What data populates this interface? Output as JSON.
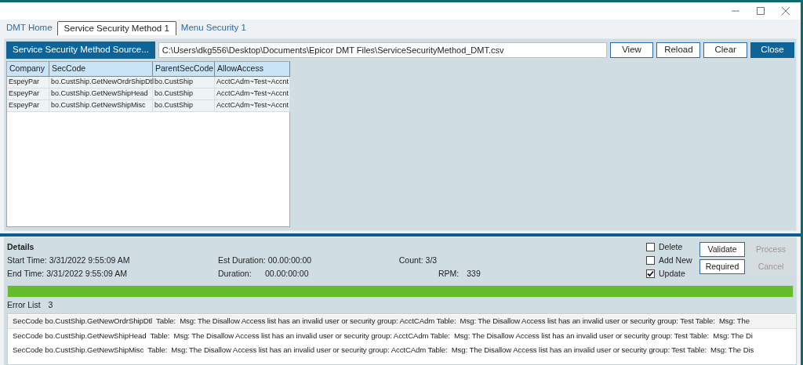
{
  "tabs": [
    {
      "label": "DMT Home",
      "selected": false
    },
    {
      "label": "Service Security Method 1",
      "selected": true
    },
    {
      "label": "Menu Security 1",
      "selected": false
    }
  ],
  "source_button": "Service Security Method Source...",
  "file_path": "C:\\Users\\dkg556\\Desktop\\Documents\\Epicor DMT Files\\ServiceSecurityMethod_DMT.csv",
  "toolbar_buttons": [
    {
      "label": "View",
      "primary": false
    },
    {
      "label": "Reload",
      "primary": false
    },
    {
      "label": "Clear",
      "primary": false
    },
    {
      "label": "Close",
      "primary": true
    }
  ],
  "table": {
    "columns": [
      "Company",
      "SecCode",
      "ParentSecCode",
      "AllowAccess"
    ],
    "rows": [
      [
        "EspeyPar",
        "bo.CustShip.GetNewOrdrShipDtl",
        "bo.CustShip",
        "AcctCAdm~Test~Accnt"
      ],
      [
        "EspeyPar",
        "bo.CustShip.GetNewShipHead",
        "bo.CustShip",
        "AcctCAdm~Test~Accnt"
      ],
      [
        "EspeyPar",
        "bo.CustShip.GetNewShipMisc",
        "bo.CustShip",
        "AcctCAdm~Test~Accnt"
      ]
    ]
  },
  "details": {
    "title": "Details",
    "start_time": "Start Time: 3/31/2022 9:55:09 AM",
    "end_time": "End Time:  3/31/2022 9:55:09 AM",
    "est_duration_label": "Est Duration:",
    "est_duration": "00.00:00:00",
    "duration_label": "Duration:",
    "duration": "00.00:00:00",
    "count": "Count: 3/3",
    "rpm_label": "RPM:",
    "rpm": "339"
  },
  "options": [
    {
      "label": "Delete",
      "checked": false
    },
    {
      "label": "Add New",
      "checked": false
    },
    {
      "label": "Update",
      "checked": true
    }
  ],
  "actions": [
    {
      "label": "Validate",
      "disabled": false
    },
    {
      "label": "Process",
      "disabled": true
    },
    {
      "label": "Required",
      "disabled": false
    },
    {
      "label": "Cancel",
      "disabled": true
    }
  ],
  "progress": {
    "level": 1
  },
  "error_list": {
    "label": "Error List",
    "count": "3",
    "rows": [
      {
        "text": "SecCode bo.CustShip.GetNewOrdrShipDtl  Table:  Msg: The Disallow Access list has an invalid user or security group: AcctCAdm Table:  Msg: The Disallow Access list has an invalid user or security group: Test Table:  Msg: The",
        "selected": true
      },
      {
        "text": "SecCode bo.CustShip.GetNewShipHead  Table:  Msg: The Disallow Access list has an invalid user or security group: AcctCAdm Table:  Msg: The Disallow Access list has an invalid user or security group: Test Table:  Msg: The Di",
        "selected": false
      },
      {
        "text": "SecCode bo.CustShip.GetNewShipMisc  Table:  Msg: The Disallow Access list has an invalid user or security group: AcctCAdm Table:  Msg: The Disallow Access list has an invalid user or security group: Test Table:  Msg: The Dis",
        "selected": false
      }
    ]
  }
}
